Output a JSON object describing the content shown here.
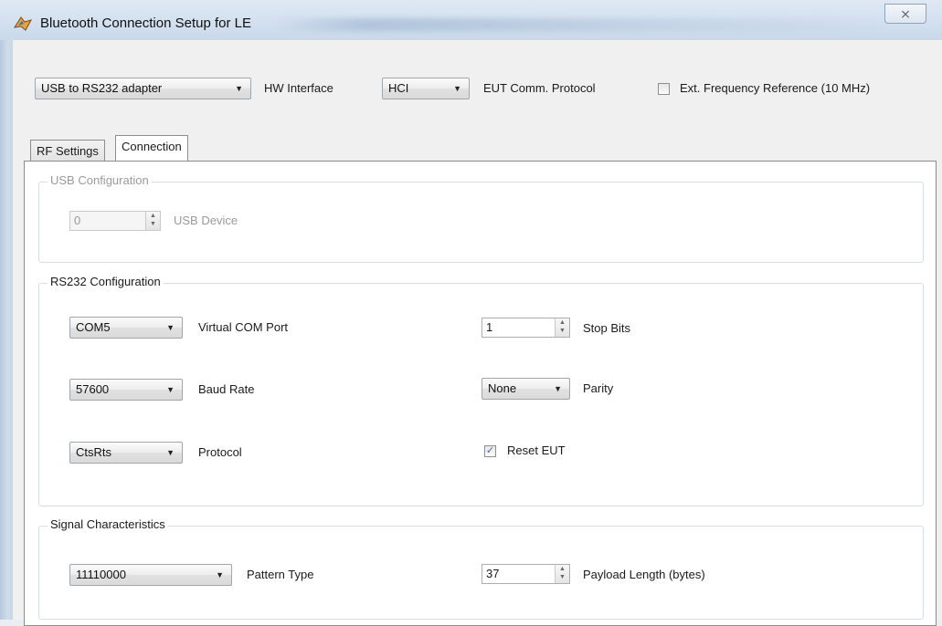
{
  "window": {
    "title": "Bluetooth Connection Setup for LE",
    "close_glyph": "⨯",
    "icon": "bluetooth-setup-app-icon"
  },
  "top": {
    "hw_interface_value": "USB to RS232 adapter",
    "hw_interface_label": "HW Interface",
    "eut_protocol_value": "HCI",
    "eut_protocol_label": "EUT Comm. Protocol",
    "ext_freq_label": "Ext. Frequency Reference (10 MHz)",
    "ext_freq_checked": false
  },
  "tabs": [
    {
      "label": "RF Settings",
      "active": false
    },
    {
      "label": "Connection",
      "active": true
    }
  ],
  "usb": {
    "group_title": "USB Configuration",
    "device_value": "0",
    "device_label": "USB Device"
  },
  "rs232": {
    "group_title": "RS232 Configuration",
    "com_port_value": "COM5",
    "com_port_label": "Virtual COM Port",
    "baud_value": "57600",
    "baud_label": "Baud Rate",
    "protocol_value": "CtsRts",
    "protocol_label": "Protocol",
    "stop_bits_value": "1",
    "stop_bits_label": "Stop Bits",
    "parity_value": "None",
    "parity_label": "Parity",
    "reset_eut_label": "Reset EUT",
    "reset_eut_checked": true
  },
  "signal": {
    "group_title": "Signal Characteristics",
    "pattern_value": "11110000",
    "pattern_label": "Pattern Type",
    "payload_value": "37",
    "payload_label": "Payload Length (bytes)"
  },
  "glyphs": {
    "dropdown_arrow": "▼",
    "check_mark": "✓",
    "spin_up": "▲",
    "spin_down": "▼"
  }
}
